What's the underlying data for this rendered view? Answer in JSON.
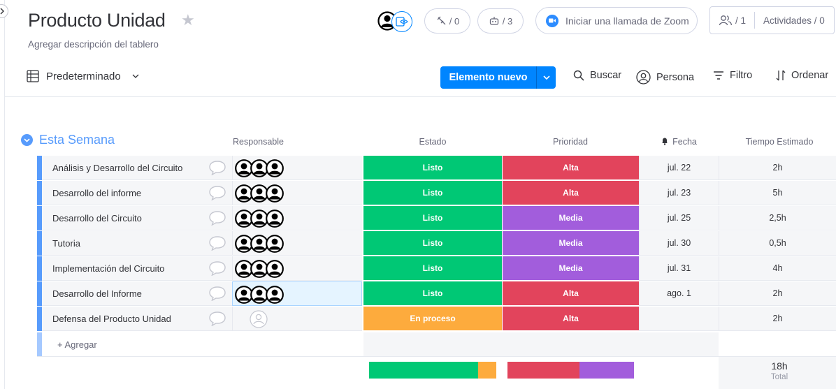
{
  "board": {
    "title": "Producto Unidad",
    "description": "Agregar descripción del tablero"
  },
  "header": {
    "integrations_count": "/ 0",
    "automations_count": "/ 3",
    "zoom_label": "Iniciar una llamada de Zoom",
    "members_count": "/ 1",
    "activities_label": "Actividades / 0"
  },
  "toolbar": {
    "view_label": "Predeterminado",
    "new_item_label": "Elemento nuevo",
    "search_label": "Buscar",
    "person_label": "Persona",
    "filter_label": "Filtro",
    "sort_label": "Ordenar"
  },
  "group": {
    "title": "Esta Semana",
    "color": "#579bfc",
    "columns": {
      "responsable": "Responsable",
      "estado": "Estado",
      "prioridad": "Prioridad",
      "fecha": "Fecha",
      "tiempo": "Tiempo Estimado"
    },
    "rows": [
      {
        "name": "Análisis y Desarrollo del Circuito",
        "estado": "Listo",
        "prioridad": "Alta",
        "fecha": "jul. 22",
        "tiempo": "2h"
      },
      {
        "name": "Desarrollo del informe",
        "estado": "Listo",
        "prioridad": "Alta",
        "fecha": "jul. 23",
        "tiempo": "5h"
      },
      {
        "name": "Desarrollo del Circuito",
        "estado": "Listo",
        "prioridad": "Media",
        "fecha": "jul. 25",
        "tiempo": "2,5h"
      },
      {
        "name": "Tutoria",
        "estado": "Listo",
        "prioridad": "Media",
        "fecha": "jul. 30",
        "tiempo": "0,5h"
      },
      {
        "name": "Implementación del Circuito",
        "estado": "Listo",
        "prioridad": "Media",
        "fecha": "jul. 31",
        "tiempo": "4h"
      },
      {
        "name": "Desarrollo del Informe",
        "estado": "Listo",
        "prioridad": "Alta",
        "fecha": "ago. 1",
        "tiempo": "2h"
      },
      {
        "name": "Defensa del Producto Unidad",
        "estado": "En proceso",
        "prioridad": "Alta",
        "fecha": "",
        "tiempo": "2h"
      }
    ],
    "add_label": "+ Agregar",
    "summary": {
      "total_value": "18h",
      "total_label": "Total",
      "estado_split": [
        {
          "label": "Listo",
          "fraction": 0.857
        },
        {
          "label": "En proceso",
          "fraction": 0.143
        }
      ],
      "prioridad_split": [
        {
          "label": "Alta",
          "fraction": 0.571
        },
        {
          "label": "Media",
          "fraction": 0.429
        }
      ]
    }
  },
  "colors": {
    "listo": "#00c875",
    "en_proceso": "#fdab3d",
    "alta": "#e2445c",
    "media": "#a25ddc",
    "primary": "#0085ff"
  }
}
